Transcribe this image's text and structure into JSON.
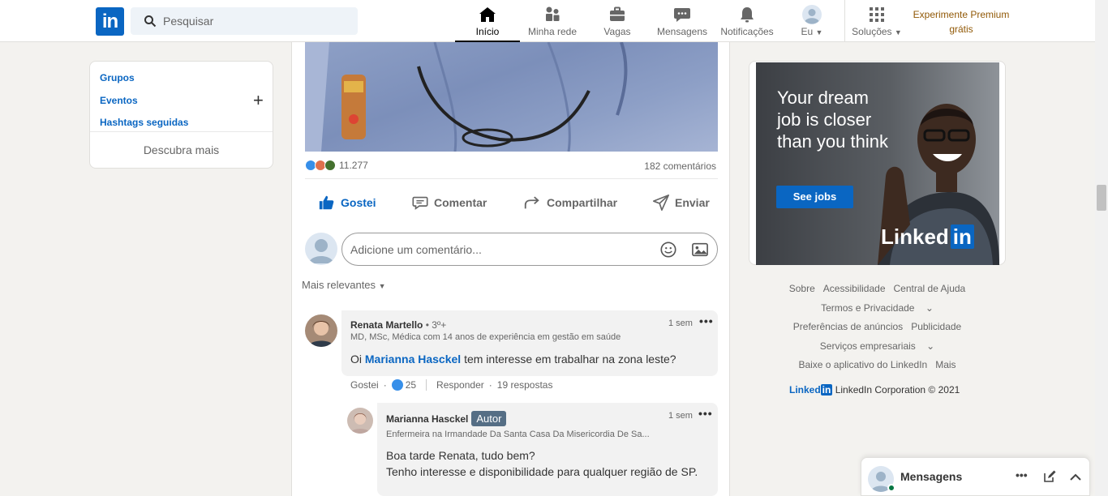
{
  "nav": {
    "logo": "in",
    "search_placeholder": "Pesquisar",
    "items": [
      {
        "label": "Início",
        "icon": "home-icon"
      },
      {
        "label": "Minha rede",
        "icon": "network-icon"
      },
      {
        "label": "Vagas",
        "icon": "briefcase-icon"
      },
      {
        "label": "Mensagens",
        "icon": "messaging-icon"
      },
      {
        "label": "Notificações",
        "icon": "bell-icon"
      },
      {
        "label": "Eu",
        "icon": "avatar"
      },
      {
        "label": "Soluções",
        "icon": "grid-icon"
      }
    ],
    "premium": "Experimente Premium grátis"
  },
  "left": {
    "links": [
      "Grupos",
      "Eventos",
      "Hashtags seguidas"
    ],
    "discover": "Descubra mais"
  },
  "post": {
    "reaction_count": "11.277",
    "comment_count": "182 comentários",
    "actions": {
      "like": "Gostei",
      "comment": "Comentar",
      "share": "Compartilhar",
      "send": "Enviar"
    },
    "comment_placeholder": "Adicione um comentário...",
    "sort": "Mais relevantes"
  },
  "comments": [
    {
      "name": "Renata Martello",
      "degree": "• 3º+",
      "headline": "MD, MSc, Médica com 14 anos de experiência em gestão em saúde",
      "time": "1 sem",
      "text_prefix": "Oi ",
      "mention": "Marianna Hasckel",
      "text_suffix": " tem interesse em trabalhar na zona leste?",
      "like_label": "Gostei",
      "like_count": "25",
      "reply_label": "Responder",
      "replies": "19 respostas"
    },
    {
      "name": "Marianna Hasckel",
      "badge": "Autor",
      "headline": "Enfermeira na Irmandade Da Santa Casa Da Misericordia De Sa...",
      "time": "1 sem",
      "line1": "Boa tarde Renata, tudo bem?",
      "line2": "Tenho interesse e disponibilidade para qualquer região de SP."
    }
  ],
  "ad": {
    "headline": "Your dream job is closer than you think",
    "button": "See jobs",
    "brand": "Linked",
    "brand_in": "in"
  },
  "footer": {
    "links": [
      "Sobre",
      "Acessibilidade",
      "Central de Ajuda",
      "Termos e Privacidade",
      "Preferências de anúncios",
      "Publicidade",
      "Serviços empresariais",
      "Baixe o aplicativo do LinkedIn",
      "Mais"
    ],
    "brand": "Linked",
    "brand_in": "in",
    "copyright": "LinkedIn Corporation © 2021"
  },
  "messaging": {
    "title": "Mensagens"
  },
  "colors": {
    "brand": "#0a66c2",
    "premium": "#915907",
    "author_badge": "#556e85"
  }
}
